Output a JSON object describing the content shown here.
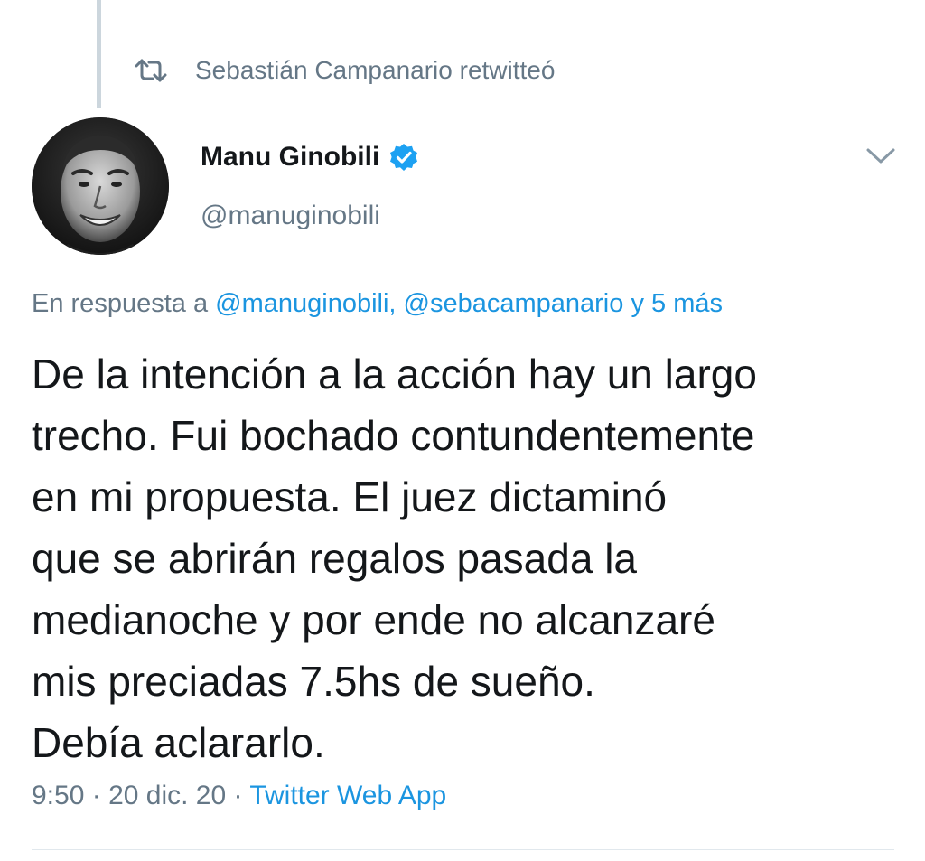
{
  "retweet": {
    "icon": "retweet-icon",
    "text": "Sebastián Campanario retwitteó"
  },
  "author": {
    "avatar_icon": "avatar-photo",
    "name": "Manu Ginobili",
    "verified_icon": "verified-badge-icon",
    "handle": "@manuginobili"
  },
  "more_menu_icon": "chevron-down-icon",
  "reply": {
    "prefix": "En respuesta a",
    "mention_1": "@manuginobili,",
    "mention_2": "@sebacampanario",
    "connector": "y",
    "more": "5 más"
  },
  "tweet": {
    "lines": [
      "De la intención a la acción hay un largo",
      "trecho. Fui bochado contundentemente",
      "en mi propuesta. El juez dictaminó",
      "que se abrirán regalos pasada la",
      "medianoche y por ende no alcanzaré",
      "mis preciadas 7.5hs de sueño.",
      "Debía aclararlo."
    ]
  },
  "meta": {
    "time": "9:50",
    "separator_1": "·",
    "date": "20 dic. 20",
    "separator_2": "·",
    "source": "Twitter Web App"
  },
  "colors": {
    "link": "#1b95e0",
    "secondary_text": "#657786",
    "primary_text": "#14171a",
    "thread_line": "#ccd6dd",
    "verified": "#1da1f2"
  }
}
